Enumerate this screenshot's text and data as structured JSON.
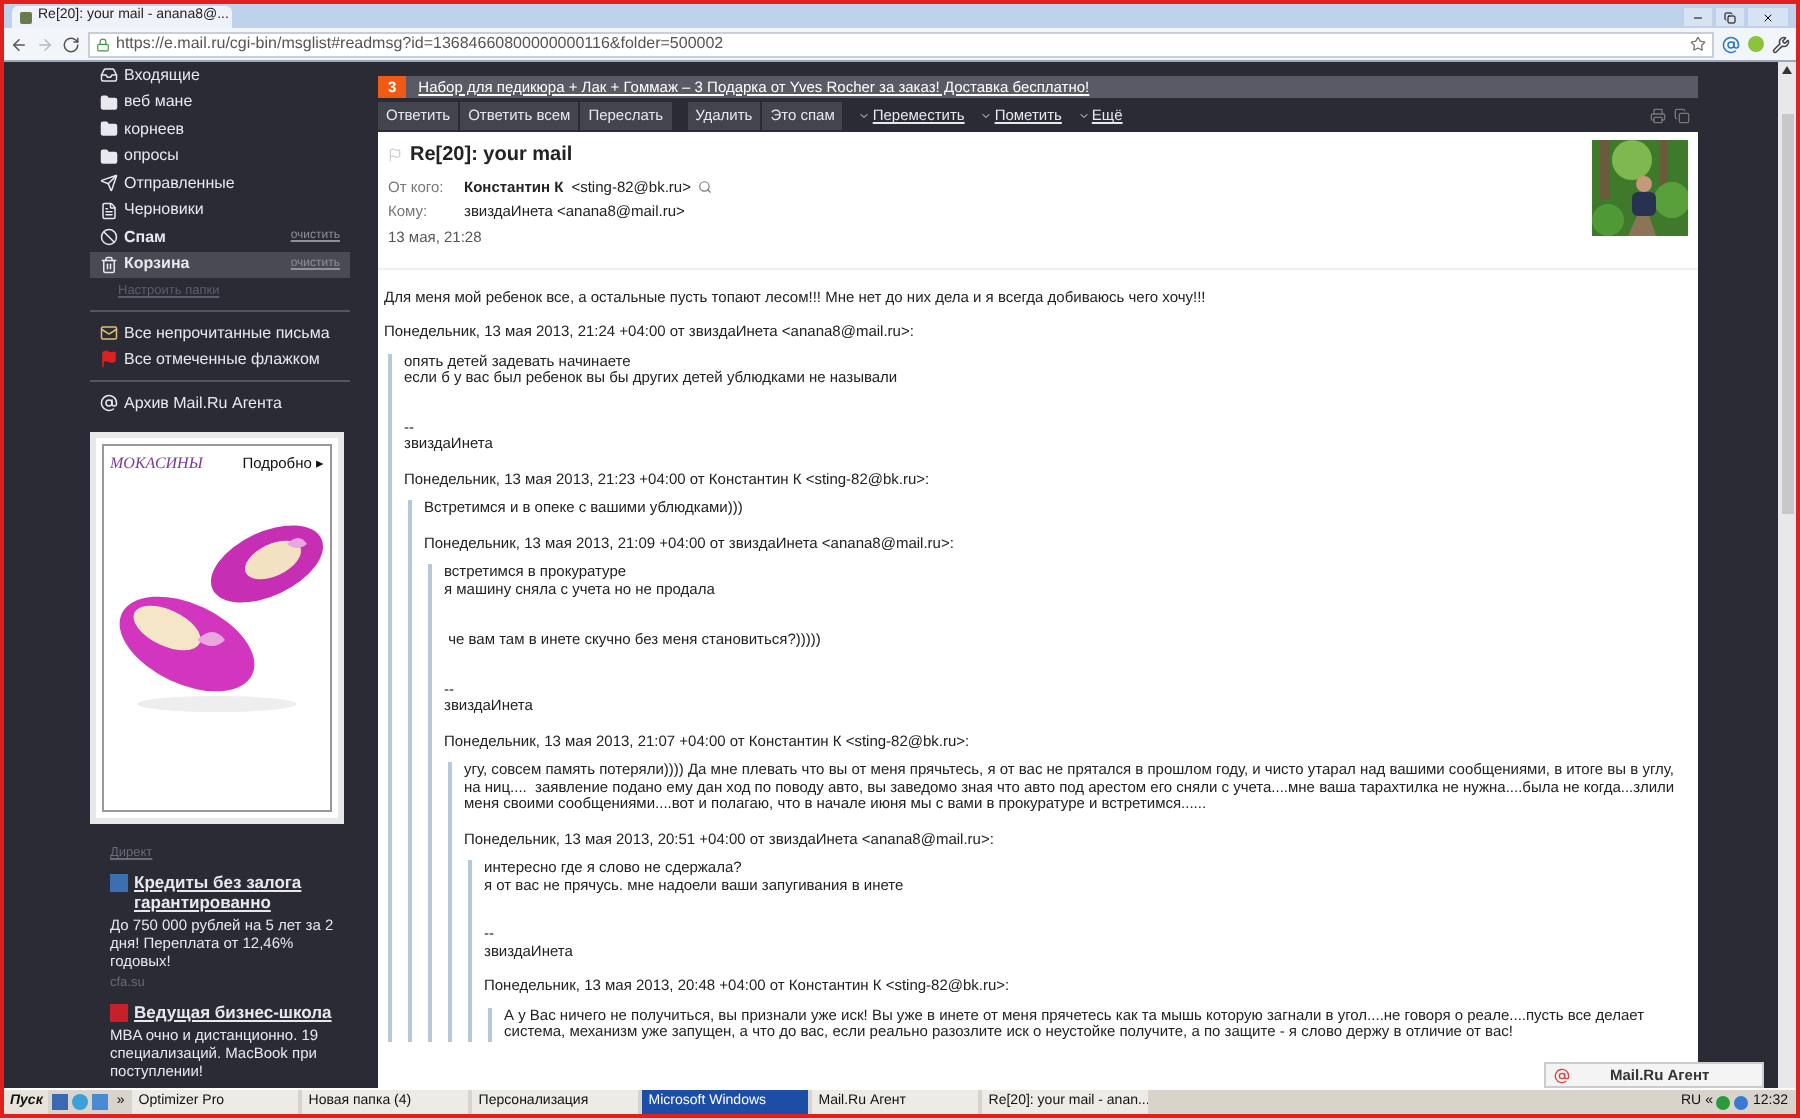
{
  "browser": {
    "tab_title": "Re[20]: your mail - anana8@...",
    "url": "https://e.mail.ru/cgi-bin/msglist#readmsg?id=13684660800000000116&folder=500002"
  },
  "sidebar": {
    "folders": [
      {
        "label": "Входящие",
        "kind": "inbox",
        "selected": false
      },
      {
        "label": "веб мане",
        "kind": "folder",
        "selected": false
      },
      {
        "label": "корнеев",
        "kind": "folder",
        "selected": false
      },
      {
        "label": "опросы",
        "kind": "folder",
        "selected": false
      },
      {
        "label": "Отправленные",
        "kind": "sent",
        "selected": false
      },
      {
        "label": "Черновики",
        "kind": "drafts",
        "selected": false
      },
      {
        "label": "Спам",
        "kind": "spam",
        "selected": false,
        "action": "очистить"
      },
      {
        "label": "Корзина",
        "kind": "trash",
        "selected": true,
        "action": "очистить"
      }
    ],
    "settings_link": "Настроить папки",
    "filters": [
      {
        "label": "Все непрочитанные письма",
        "kind": "unread"
      },
      {
        "label": "Все отмеченные флажком",
        "kind": "flagged"
      }
    ],
    "archive": "Архив Mail.Ru Агента",
    "banner": {
      "title": "МОКАСИНЫ",
      "more": "Подробно ▸",
      "kind": "picture"
    },
    "direct_label": "Директ",
    "ads": [
      {
        "title": "Кредиты без залога гарантированно",
        "text": "До 750 000 рублей на 5 лет за 2 дня! Переплата от 12,46% годовых!",
        "domain": "cfa.su",
        "color": "#3a6fb0"
      },
      {
        "title": "Ведущая бизнес-школа",
        "text": "MBA очно и дистанционно. 19 специализаций. MacBook при поступлении!",
        "color": "#c8202a"
      }
    ]
  },
  "promo": {
    "count": "3",
    "text": "Набор для педикюра + Лак + Гоммаж – 3 Подарка от Yves Rocher за заказ! Доставка бесплатно!"
  },
  "toolbar": {
    "groups": [
      [
        "Ответить",
        "Ответить всем",
        "Переслать"
      ],
      [
        "Удалить",
        "Это спам"
      ]
    ],
    "menus": [
      "Переместить",
      "Пометить",
      "Ещё"
    ]
  },
  "message": {
    "subject": "Re[20]: your mail",
    "from_label": "От кого:",
    "from_name": "Константин К",
    "from_email": "<sting-82@bk.ru>",
    "to_label": "Кому:",
    "to": "звиздаИнета <anana8@mail.ru>",
    "date": "13 мая, 21:28",
    "text": "Для меня мой ребенок все, а остальные пусть топают лесом!!! Мне нет до них дела и я всегда добиваюсь чего хочу!!!",
    "quotes": [
      {
        "header": "Понедельник, 13 мая 2013, 21:24 +04:00 от звиздаИнета <anana8@mail.ru>:",
        "paragraphs": [
          [
            "опять детей задевать начинаете",
            "если б у вас был ребенок вы бы других детей ублюдками не называли"
          ]
        ],
        "signature": [
          "--",
          "звиздаИнета"
        ],
        "children": [
          {
            "header": "Понедельник, 13 мая 2013, 21:23 +04:00 от Константин К <sting-82@bk.ru>:",
            "paragraphs": [
              [
                "Встретимся и в опеке с вашими ублюдками)))"
              ]
            ],
            "children": [
              {
                "header": "Понедельник, 13 мая 2013, 21:09 +04:00 от звиздаИнета <anana8@mail.ru>:",
                "paragraphs": [
                  [
                    "встретимся в прокуратуре",
                    "я машину сняла с учета но не продала"
                  ],
                  [
                    " че вам там в инете скучно без меня становиться?)))))"
                  ]
                ],
                "signature": [
                  "--",
                  "звиздаИнета"
                ],
                "children": [
                  {
                    "header": "Понедельник, 13 мая 2013, 21:07 +04:00 от Константин К <sting-82@bk.ru>:",
                    "paragraphs": [
                      [
                        "угу, совсем память потеряли)))) Да мне плевать что вы от меня прячьтесь, я от вас не прятался в прошлом году, и чисто утарал над вашими сообщениями, в итоге вы в углу, на ниц....  заявление подано ему дан ход по поводу авто, вы заведомо зная что авто под арестом его сняли с учета....мне ваша тарахтилка не нужна....была не когда...злили меня своими сообщениями....вот и полагаю, что в начале июня мы с вами в прокуратуре и встретимся......"
                      ]
                    ],
                    "children": [
                      {
                        "header": "Понедельник, 13 мая 2013, 20:51 +04:00 от звиздаИнета <anana8@mail.ru>:",
                        "paragraphs": [
                          [
                            "интересно где я слово не сдержала?",
                            "я от вас не прячусь. мне надоели ваши запугивания в инете"
                          ]
                        ],
                        "signature": [
                          "--",
                          "звиздаИнета"
                        ],
                        "children": [
                          {
                            "header": "Понедельник, 13 мая 2013, 20:48 +04:00 от Константин К <sting-82@bk.ru>:",
                            "paragraphs": [
                              [
                                "А у Вас ничего не получиться, вы признали уже иск! Вы уже в инете от меня прячетесь как та мышь которую загнали в угол....не говоря о реале....пусть все делает система, механизм уже запущен, а что до вас, если реально разозлите иск о неустойке получите, а по защите - я слово держу в отличие от вас!"
                              ]
                            ]
                          }
                        ]
                      }
                    ]
                  }
                ]
              }
            ]
          }
        ]
      }
    ]
  },
  "agent_popup": "Mail.Ru Агент",
  "taskbar": {
    "start": "Пуск",
    "chevron": "»",
    "tasks": [
      {
        "label": "Optimizer Pro",
        "selected": false
      },
      {
        "label": "Новая папка (4)",
        "selected": false
      },
      {
        "label": "Персонализация",
        "selected": false
      },
      {
        "label": "Microsoft Windows",
        "selected": true
      },
      {
        "label": "Mail.Ru Агент",
        "selected": false
      },
      {
        "label": "Re[20]: your mail - anan...",
        "selected": false
      }
    ],
    "language": "RU",
    "tray_chevron": "«",
    "clock": "12:32"
  }
}
